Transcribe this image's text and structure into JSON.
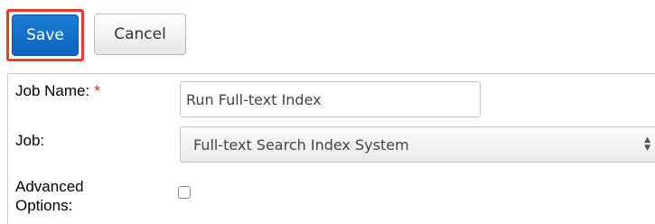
{
  "toolbar": {
    "save_label": "Save",
    "cancel_label": "Cancel"
  },
  "form": {
    "job_name": {
      "label": "Job Name:",
      "required_marker": "*",
      "value": "Run Full-text Index"
    },
    "job": {
      "label": "Job:",
      "selected": "Full-text Search Index System"
    },
    "advanced_options": {
      "label_line1": "Advanced",
      "label_line2": "Options:",
      "checked": false
    }
  },
  "colors": {
    "primary_button": "#0b63bf",
    "highlight": "#ef3b24",
    "required": "#d11f1f"
  }
}
